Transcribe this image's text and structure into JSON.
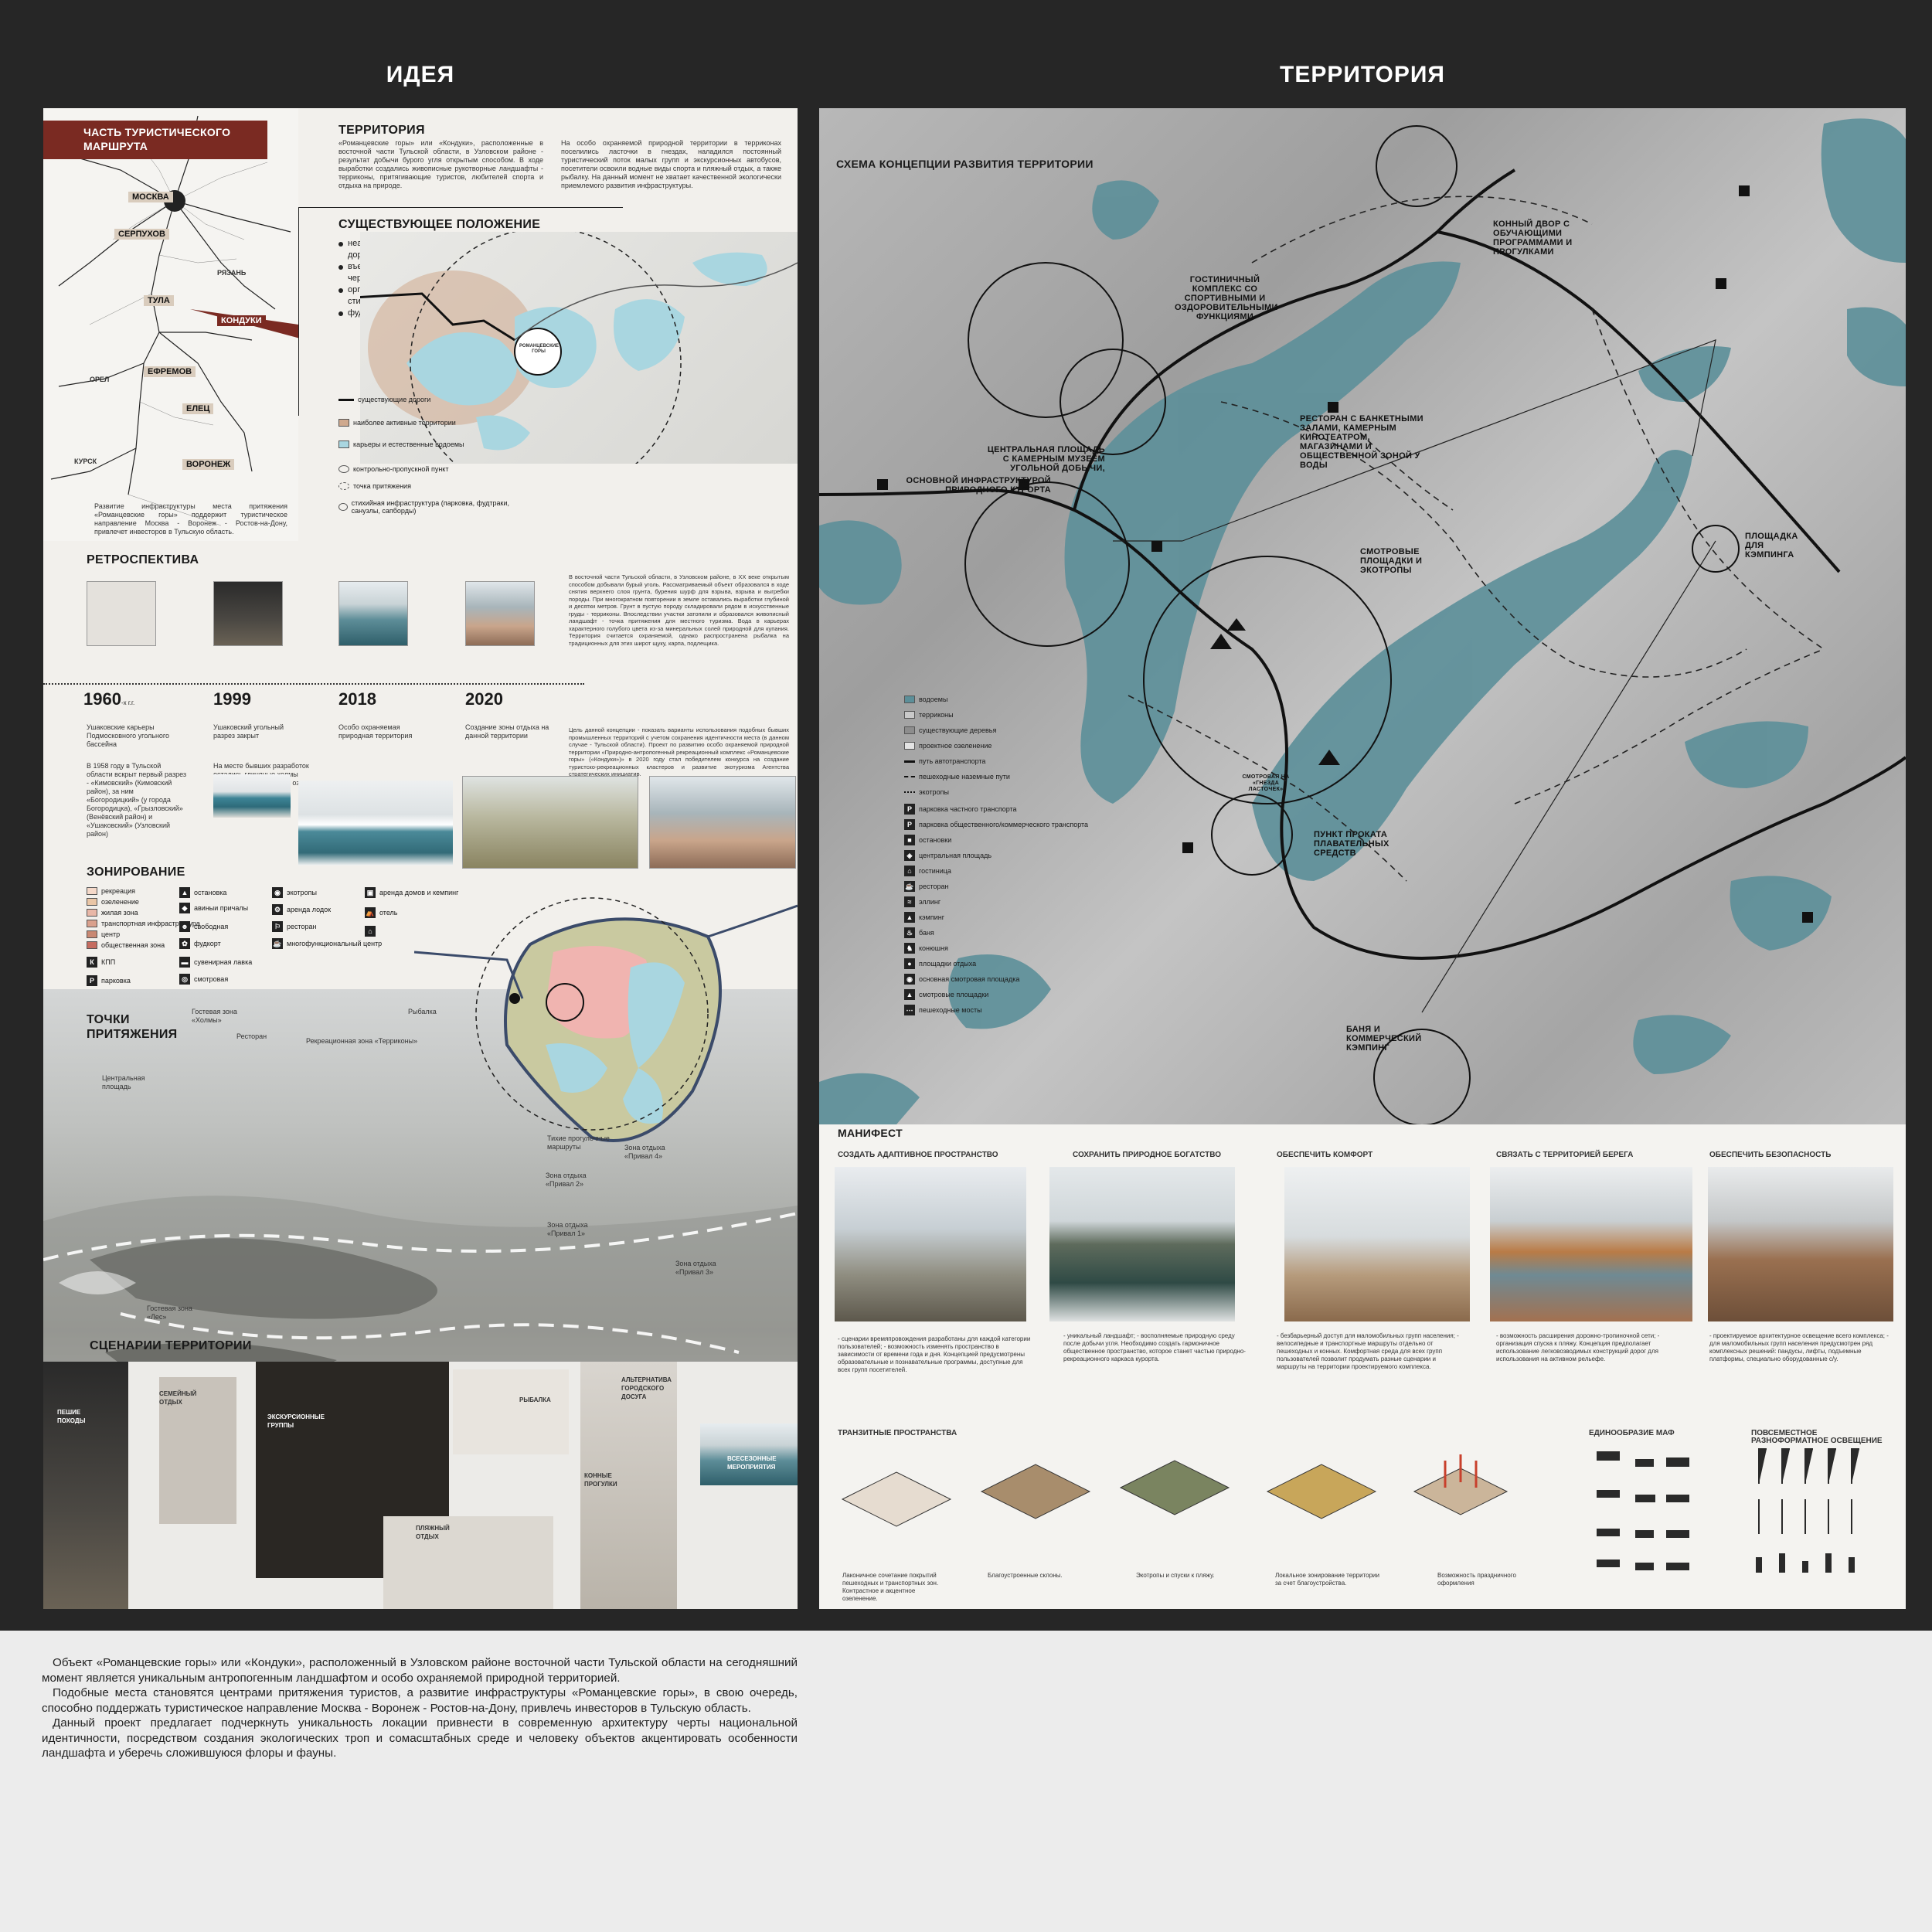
{
  "titles": {
    "idea": "ИДЕЯ",
    "territory": "ТЕРРИТОРИЯ"
  },
  "route_map": {
    "header": "ЧАСТЬ ТУРИСТИЧЕСКОГО МАРШРУТА",
    "cities": [
      "МОСКВА",
      "СЕРПУХОВ",
      "РЯЗАНЬ",
      "ТУЛА",
      "КОНДУКИ",
      "ЕФРЕМОВ",
      "ОРЕЛ",
      "ЕЛЕЦ",
      "КУРСК",
      "ВОРОНЕЖ"
    ],
    "caption": "Развитие инфраструктуры места притяжения «Романцевские горы» поддержит туристическое направление Москва - Воронеж - Ростов-на-Дону, привлечет инвесторов в Тульскую область."
  },
  "territory": {
    "heading": "ТЕРРИТОРИЯ",
    "text1": "«Романцевские горы» или «Кондуки», расположенные в восточной части Тульской области, в Узловском районе - результат добычи бурого угля открытым способом. В ходе выработки создались живописные рукотворные ландшафты - терриконы, притягивающие туристов, любителей спорта и отдыха на природе.",
    "text2": "На особо охраняемой природной территории в терриконах поселились ласточки в гнездах, наладился постоянный туристический поток малых групп и экскурсионных автобусов, посетители освоили водные виды спорта и пляжный отдых, а также рыбалку. На данный момент не хватает качественной экологически приемлемого развития инфраструктуры."
  },
  "existing": {
    "heading": "СУЩЕСТВУЮЩЕЕ ПОЛОЖЕНИЕ",
    "items": [
      "неасфальтированные дороги",
      "въезд на территорию через КПП",
      "организованная и стихийная парковка",
      "фудтраки"
    ],
    "center_label": "РОМАНЦЕВСКИЕ ГОРЫ",
    "legend": [
      "существующие дороги",
      "наиболее активные территории",
      "карьеры и естественные водоемы",
      "контрольно-пропускной пункт",
      "точка притяжения",
      "стихийная инфраструктура (парковка, фудтраки, санузлы, сапборды)"
    ]
  },
  "retro": {
    "heading": "РЕТРОСПЕКТИВА",
    "years": [
      "1960",
      "1999",
      "2018",
      "2020"
    ],
    "year_suffix": "-х г.г.",
    "texts": [
      "Ушаковские карьеры Подмосковного угольного бассейна",
      "Ушаковский угольный разрез закрыт",
      "Особо охраняемая природная территория",
      "Создание зоны отдыха на данной территории"
    ],
    "note1958": "В 1958 году в Тульской области вскрыт первый разрез - «Кимовский» (Кимовский район), за ним «Богородицкий» (у города Богородицка), «Грызловский» (Венёвский район) и «Ушаковский» (Узловский район)",
    "note_clay": "На месте бывших разработок остались глиняные холмы высотой до 50 метров и озера с голубой водой",
    "right1": "В восточной части Тульской области, в Узловском районе, в XX веке открытым способом добывали бурый уголь. Рассматриваемый объект образовался в ходе снятия верхнего слоя грунта, бурения шурф для взрыва, взрыва и выгребки породы. При многократном повторении в земле оставались выработки глубиной и десятки метров. Грунт в пустую породу складировали рядом в искусственные груды - терриконы. Впоследствии участки затопили и образовался живописный ландшафт - точка притяжения для местного туризма. Вода в карьерах характерного голубого цвета из-за минеральных солей природной для купания. Территория считается охраняемой, однако распространена рыбалка на традиционных для этих широт щуку, карпа, подлещика.",
    "right2": "Цель данной концепции - показать варианты использования подобных бывших промышленных территорий с учетом сохранения идентичности места (в данном случае - Тульской области). Проект по развитию особо охраняемой природной территории «Природно-антропогенный рекреационный комплекс «Романцевские горы» («Кондуки»)» в 2020 году стал победителем конкурса на создание туристско-рекреационных кластеров и развитие экотуризма Агентства стратегических инициатив."
  },
  "zoning": {
    "heading": "ЗОНИРОВАНИЕ",
    "legend": [
      "рекреация",
      "озеленение",
      "жилая зона",
      "транспортная инфраструктура",
      "центр",
      "общественная зона",
      "КПП",
      "парковка",
      "остановка",
      "авиныи причалы",
      "свободная",
      "фудкорт",
      "сувенирная лавка",
      "смотровая",
      "экотропы",
      "аренда лодок",
      "ресторан",
      "многофункциональный центр",
      "аренда домов и кемпинг",
      "отель"
    ]
  },
  "attraction": {
    "heading": "ТОЧКИ ПРИТЯЖЕНИЯ",
    "labels": [
      "Гостевая зона «Холмы»",
      "Ресторан",
      "Рекреационная зона «Терриконы»",
      "Рыбалка",
      "Центральная площадь",
      "Тихие прогулочные маршруты",
      "Зона отдыха «Привал 4»",
      "Зона отдыха «Привал 2»",
      "Зона отдыха «Привал 1»",
      "Зона отдыха «Привал 3»",
      "Гостевая зона «Лес»"
    ]
  },
  "scenarios": {
    "heading": "СЦЕНАРИИ ТЕРРИТОРИИ",
    "labels": [
      "ПЕШИЕ ПОХОДЫ",
      "СЕМЕЙНЫЙ ОТДЫХ",
      "ЭКСКУРСИОННЫЕ ГРУППЫ",
      "РЫБАЛКА",
      "АЛЬТЕРНАТИВА ГОРОДСКОГО ДОСУГА",
      "КОННЫЕ ПРОГУЛКИ",
      "ПЛЯЖНЫЙ ОТДЫХ",
      "ВСЕСЕЗОННЫЕ МЕРОПРИЯТИЯ"
    ]
  },
  "concept": {
    "heading": "СХЕМА КОНЦЕПЦИИ РАЗВИТИЯ ТЕРРИТОРИИ",
    "labels": [
      "КОННЫЙ ДВОР С ОБУЧАЮЩИМИ ПРОГРАММАМИ И ПРОГУЛКАМИ",
      "ГОСТИНИЧНЫЙ КОМПЛЕКС СО СПОРТИВНЫМИ И ОЗДОРОВИТЕЛЬНЫМИ ФУНКЦИЯМИ",
      "РЕСТОРАН С БАНКЕТНЫМИ ЗАЛАМИ, КАМЕРНЫМ КИНОТЕАТРОМ, МАГАЗИНАМИ И ОБЩЕСТВЕННОЙ ЗОНОЙ У ВОДЫ",
      "ЦЕНТРАЛЬНАЯ ПЛОЩАДЬ С КАМЕРНЫМ МУЗЕЕМ УГОЛЬНОЙ ДОБЫЧИ,",
      "ОСНОВНОЙ ИНФРАСТРУКТУРОЙ ПРИРОДНОГО КУРОРТА",
      "СМОТРОВЫЕ ПЛОЩАДКИ И ЭКОТРОПЫ",
      "ПЛОЩАДКА ДЛЯ КЭМПИНГА",
      "СМОТРОВАЯ НА «ГНЕЗДА ЛАСТОЧЕК»",
      "ПУНКТ ПРОКАТА ПЛАВАТЕЛЬНЫХ СРЕДСТВ",
      "БАНЯ И КОММЕРЧЕСКИЙ КЭМПИНГ"
    ],
    "legend": [
      "водоемы",
      "терриконы",
      "существующие деревья",
      "проектное озеленение",
      "путь автотранспорта",
      "пешеходные наземные пути",
      "экотропы",
      "парковка частного транспорта",
      "парковка общественного/коммерческого транспорта",
      "остановки",
      "центральная площадь",
      "гостиница",
      "ресторан",
      "эллинг",
      "кэмпинг",
      "баня",
      "конюшня",
      "площадки отдыха",
      "основная смотровая площадка",
      "смотровые площадки",
      "пешеходные мосты"
    ]
  },
  "manifest": {
    "heading": "МАНИФЕСТ",
    "columns": [
      {
        "title": "СОЗДАТЬ АДАПТИВНОЕ ПРОСТРАНСТВО",
        "text": "- сценарии времяпровождения разработаны для каждой категории пользователей; - возможность изменять пространство в зависимости от времени года и дня. Концепцией предусмотрены образовательные и познавательные программы, доступные для всех групп посетителей."
      },
      {
        "title": "СОХРАНИТЬ ПРИРОДНОЕ БОГАТСТВО",
        "text": "- уникальный ландшафт; - восполняемые природную среду после добычи угля. Необходимо создать гармоничное общественное пространство, которое станет частью природно-рекреационного каркаса курорта."
      },
      {
        "title": "ОБЕСПЕЧИТЬ КОМФОРТ",
        "text": "- безбарьерный доступ для маломобильных групп населения; - велосипедные и транспортные маршруты отдельно от пешеходных и конных. Комфортная среда для всех групп пользователей позволит продумать разные сценарии и маршруты на территории проектируемого комплекса."
      },
      {
        "title": "СВЯЗАТЬ С ТЕРРИТОРИЕЙ БЕРЕГА",
        "text": "- возможность расширения дорожно-тропиночной сети; - организация спуска к пляжу. Концепция предполагает использование легковозводимых конструкций дорог для использования на активном рельефе."
      },
      {
        "title": "ОБЕСПЕЧИТЬ БЕЗОПАСНОСТЬ",
        "text": "- проектируемое архитектурное освещение всего комплекса; - для маломобильных групп населения предусмотрен ряд комплексных решений: пандусы, лифты, подъемные платформы, специально оборудованные с/у."
      }
    ]
  },
  "transit": {
    "heading": "ТРАНЗИТНЫЕ ПРОСТРАНСТВА",
    "captions": [
      "Лаконичное сочетание покрытий пешеходных и транспортных зон. Контрастное и акцентное озеленение.",
      "Благоустроенные склоны.",
      "Экотропы и спуски к пляжу.",
      "Локальное зонирование территории за счет благоустройства.",
      "Возможность праздничного оформления"
    ]
  },
  "maf": {
    "heading": "ЕДИНООБРАЗИЕ МАФ",
    "lighting_heading": "ПОВСЕМЕСТНОЕ РАЗНОФОРМАТНОЕ ОСВЕЩЕНИЕ"
  },
  "description": [
    "Объект «Романцевские горы» или «Кондуки», расположенный в Узловском районе восточной части Тульской области на сегодняшний момент является уникальным антропогенным ландшафтом и особо охраняемой природной территорией.",
    "Подобные места становятся центрами притяжения туристов, а развитие инфраструктуры «Романцевские горы», в свою очередь, способно поддержать туристическое направление Москва - Воронеж - Ростов-на-Дону, привлечь инвесторов в Тульскую область.",
    "Данный проект предлагает подчеркнуть уникальность локации привнести в современную архитектуру черты национальной идентичности, посредством создания экологических троп и сомасштабных среде и человеку объектов акцентировать особенности ландшафта и уберечь сложившуюся флоры и фауны."
  ]
}
